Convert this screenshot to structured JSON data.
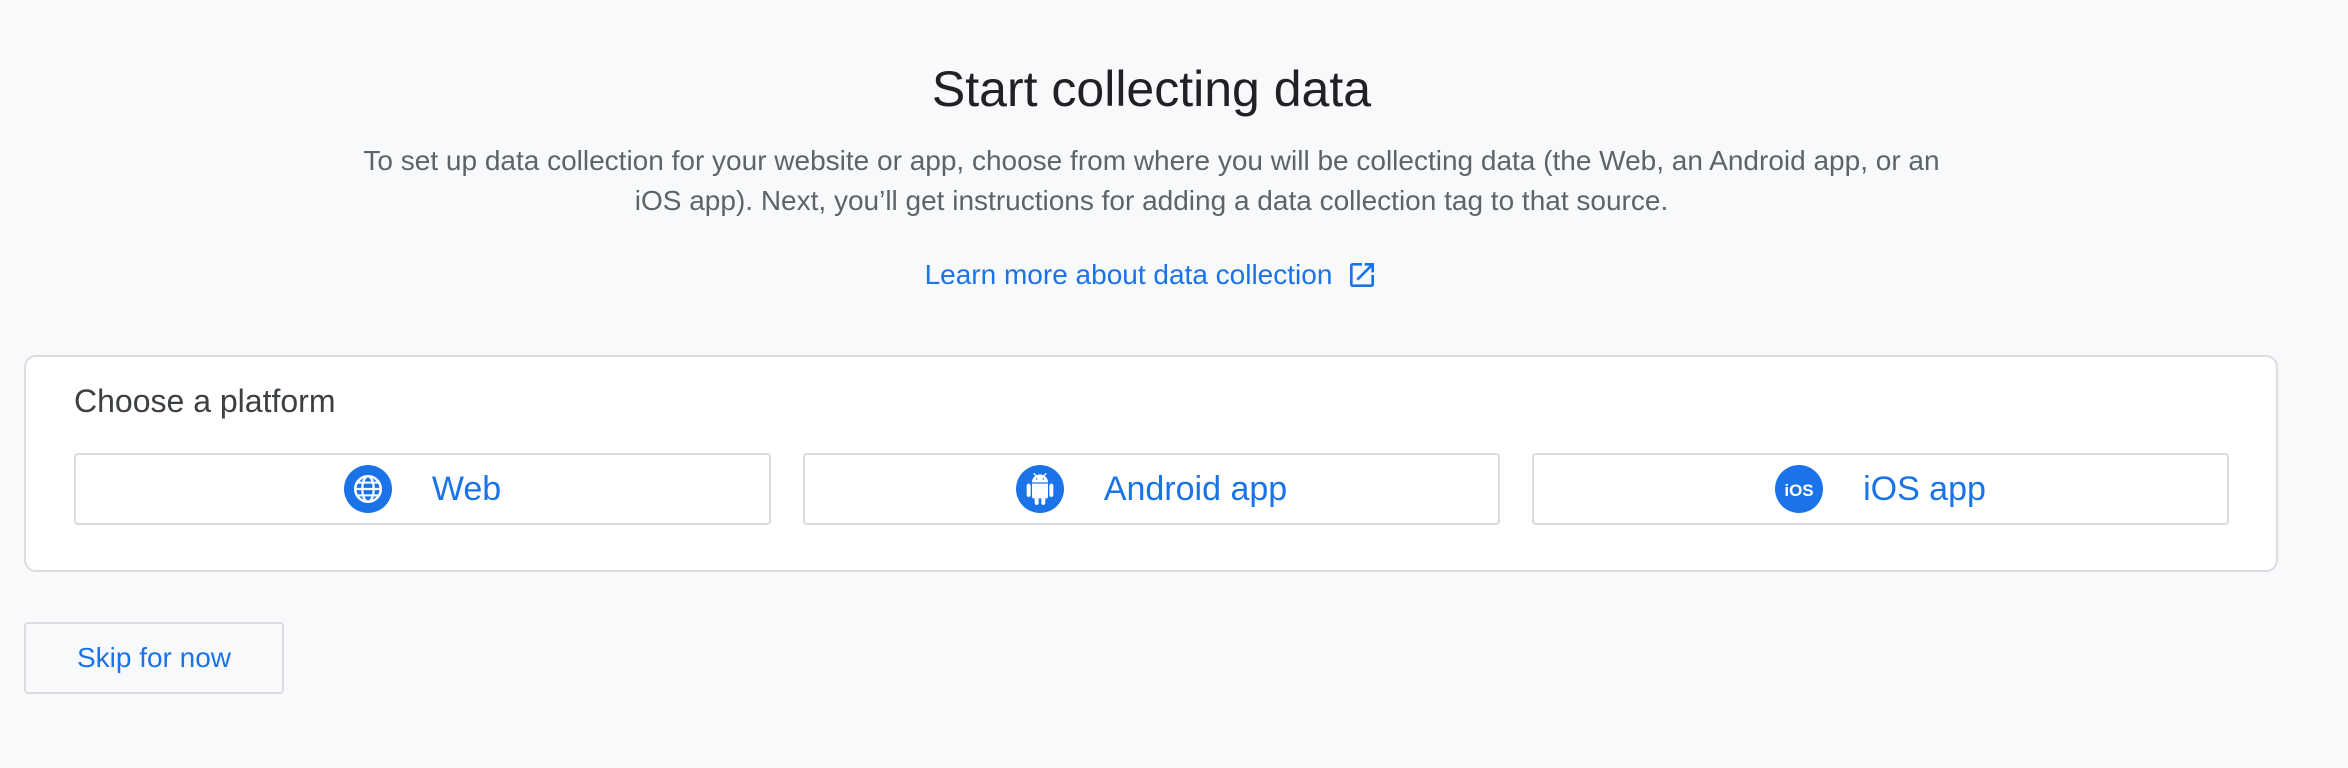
{
  "header": {
    "title": "Start collecting data",
    "description": "To set up data collection for your website or app, choose from where you will be collecting data (the Web, an Android app, or an iOS app). Next, you’ll get instructions for adding a data collection tag to that source.",
    "learn_more_label": "Learn more about data collection",
    "learn_more_icon": "open-in-new-icon"
  },
  "platform_card": {
    "title": "Choose a platform",
    "options": [
      {
        "label": "Web",
        "icon": "globe-icon"
      },
      {
        "label": "Android app",
        "icon": "android-icon"
      },
      {
        "label": "iOS app",
        "icon": "ios-icon"
      }
    ]
  },
  "footer": {
    "skip_label": "Skip for now"
  },
  "colors": {
    "accent": "#1a73e8",
    "border": "#dadce0",
    "background": "#f8f9fa",
    "title_text": "#202124",
    "body_text": "#5f6368"
  }
}
